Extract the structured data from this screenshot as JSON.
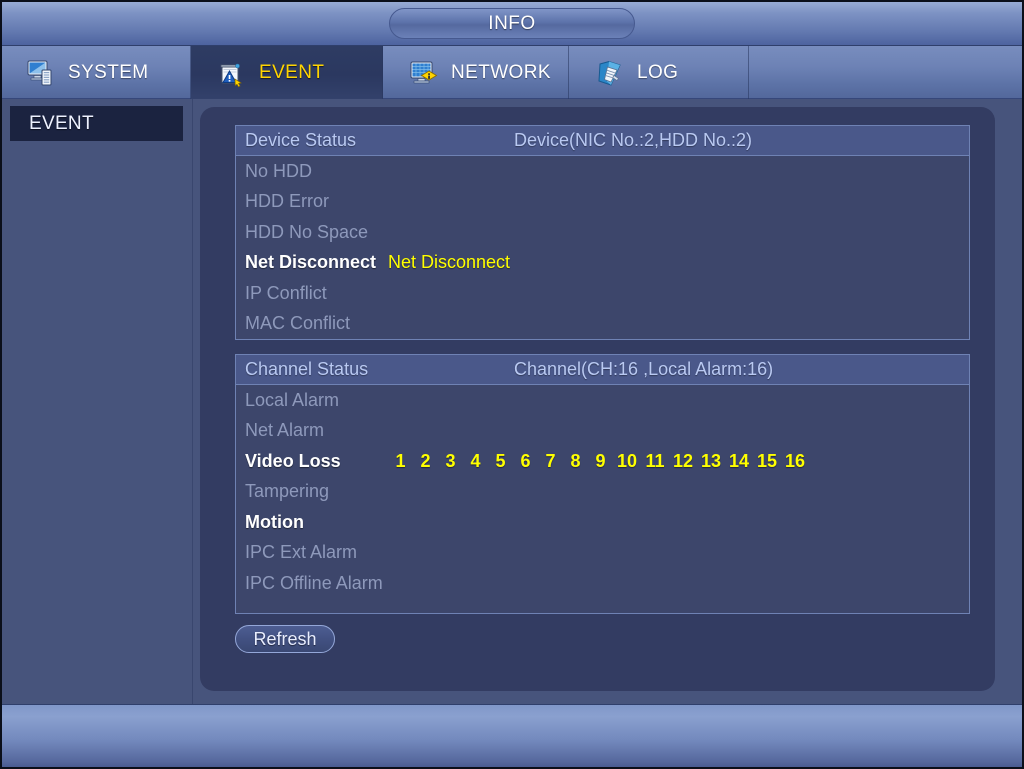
{
  "window": {
    "title": "INFO"
  },
  "tabs": [
    {
      "label": "SYSTEM",
      "icon": "monitor-icon",
      "active": false
    },
    {
      "label": "EVENT",
      "icon": "event-warning-icon",
      "active": true
    },
    {
      "label": "NETWORK",
      "icon": "network-icon",
      "active": false
    },
    {
      "label": "LOG",
      "icon": "log-book-icon",
      "active": false
    }
  ],
  "sidebar": {
    "items": [
      {
        "label": "EVENT",
        "selected": true
      }
    ]
  },
  "device_panel": {
    "header_left": "Device Status",
    "header_right": "Device(NIC No.:2,HDD No.:2)",
    "rows": [
      {
        "label": "No HDD",
        "value": "",
        "state": "dim"
      },
      {
        "label": "HDD Error",
        "value": "",
        "state": "dim"
      },
      {
        "label": "HDD No Space",
        "value": "",
        "state": "dim"
      },
      {
        "label": "Net Disconnect",
        "value": "Net Disconnect",
        "state": "live"
      },
      {
        "label": "IP Conflict",
        "value": "",
        "state": "dim"
      },
      {
        "label": "MAC Conflict",
        "value": "",
        "state": "dim"
      }
    ]
  },
  "channel_panel": {
    "header_left": "Channel Status",
    "header_right": "Channel(CH:16 ,Local Alarm:16)",
    "rows": [
      {
        "label": "Local Alarm",
        "state": "dim",
        "channels": []
      },
      {
        "label": "Net Alarm",
        "state": "dim",
        "channels": []
      },
      {
        "label": "Video Loss",
        "state": "live",
        "channels": [
          "1",
          "2",
          "3",
          "4",
          "5",
          "6",
          "7",
          "8",
          "9",
          "10",
          "11",
          "12",
          "13",
          "14",
          "15",
          "16"
        ]
      },
      {
        "label": "Tampering",
        "state": "dim",
        "channels": []
      },
      {
        "label": "Motion",
        "state": "live",
        "channels": []
      },
      {
        "label": "IPC Ext Alarm",
        "state": "dim",
        "channels": []
      },
      {
        "label": "IPC Offline Alarm",
        "state": "dim",
        "channels": []
      }
    ]
  },
  "buttons": {
    "refresh": "Refresh"
  },
  "colors": {
    "accent_yellow": "#ffff00",
    "panel_bg": "#3d466b",
    "panel_header_bg": "#4a588a",
    "card_bg": "#333c62",
    "chrome_blue": "#6d82b5"
  }
}
